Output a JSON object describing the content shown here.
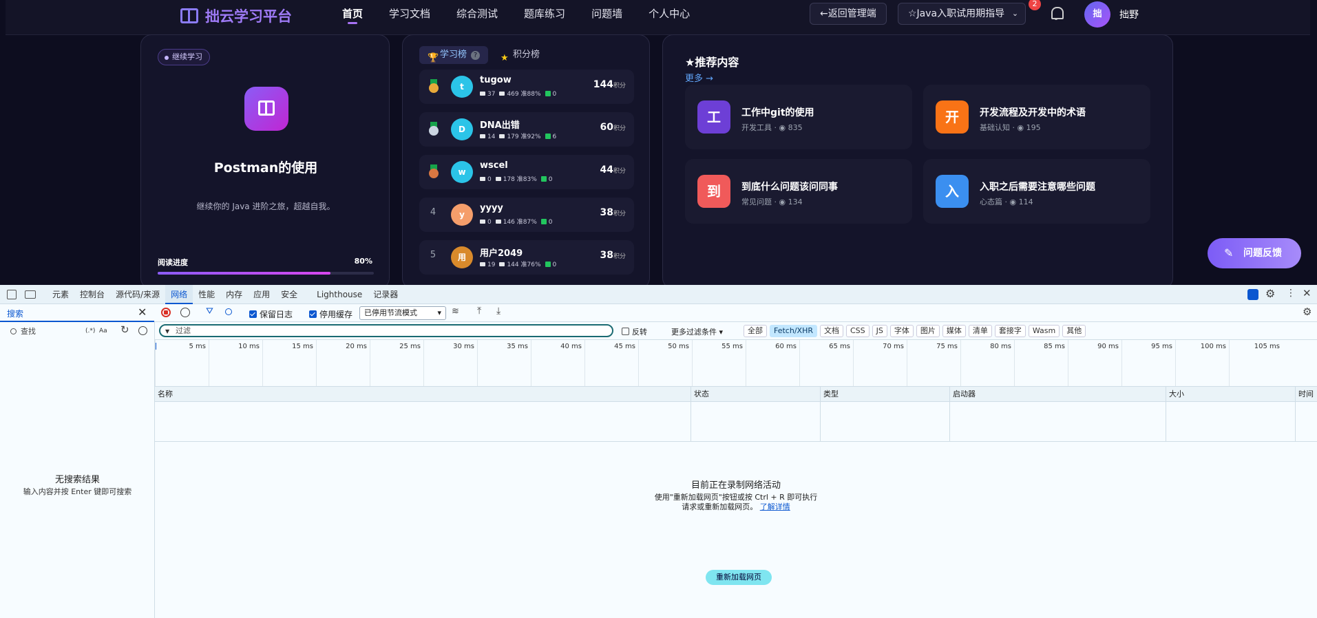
{
  "app": {
    "logo_text": "拙云学习平台",
    "nav": [
      "首页",
      "学习文档",
      "综合测试",
      "题库练习",
      "问题墙",
      "个人中心"
    ],
    "back_admin": "←返回管理端",
    "guide_select": "☆Java入职试用期指导",
    "notification_count": "2",
    "avatar_text": "拙",
    "username": "拙野"
  },
  "continue_card": {
    "chip": "继续学习",
    "title": "Postman的使用",
    "subtitle": "继续你的 Java 进阶之旅，超越自我。",
    "progress_label": "阅读进度",
    "progress_text": "80%",
    "progress_value": 0.8
  },
  "leaderboard": {
    "tab_study": "学习榜",
    "tab_points": "积分榜",
    "help": "?",
    "score_unit": "积分",
    "rows": [
      {
        "rank": "",
        "medal": "#e8a93a",
        "avatar": "t",
        "avatar_color": "#2bc4e8",
        "name": "tugow",
        "msgs": "37",
        "docs": "469 准88%",
        "done": "0",
        "score": "144"
      },
      {
        "rank": "",
        "medal": "#cbd5e1",
        "avatar": "D",
        "avatar_color": "#2bc4e8",
        "name": "DNA出错",
        "msgs": "14",
        "docs": "179 准92%",
        "done": "6",
        "score": "60"
      },
      {
        "rank": "",
        "medal": "#d97742",
        "avatar": "w",
        "avatar_color": "#2bc4e8",
        "name": "wscel",
        "msgs": "0",
        "docs": "178 准83%",
        "done": "0",
        "score": "44"
      },
      {
        "rank": "4",
        "medal": "",
        "avatar": "y",
        "avatar_color": "#f59e6b",
        "name": "yyyy",
        "msgs": "0",
        "docs": "146 准87%",
        "done": "0",
        "score": "38"
      },
      {
        "rank": "5",
        "medal": "",
        "avatar": "用",
        "avatar_color": "#d98a2b",
        "name": "用户2049",
        "msgs": "19",
        "docs": "144 准76%",
        "done": "0",
        "score": "38"
      }
    ]
  },
  "recommend": {
    "title": "★推荐内容",
    "more": "更多 →",
    "items": [
      {
        "icon": "工",
        "color": "#6d3fd6",
        "name": "工作中git的使用",
        "category": "开发工具",
        "views": "835"
      },
      {
        "icon": "开",
        "color": "#f97316",
        "name": "开发流程及开发中的术语",
        "category": "基础认知",
        "views": "195"
      },
      {
        "icon": "到",
        "color": "#f05a5a",
        "name": "到底什么问题该问同事",
        "category": "常见问题",
        "views": "134"
      },
      {
        "icon": "入",
        "color": "#3b8ff0",
        "name": "入职之后需要注意哪些问题",
        "category": "心态篇",
        "views": "114"
      }
    ]
  },
  "feedback": "问题反馈",
  "devtools": {
    "tabs": [
      "元素",
      "控制台",
      "源代码/来源",
      "网络",
      "性能",
      "内存",
      "应用",
      "安全",
      "Lighthouse",
      "记录器"
    ],
    "active_tab": "网络",
    "search_tab": "搜索",
    "search_placeholder": "查找",
    "regex": "(.*)",
    "case": "Aa",
    "preserve_log": "保留日志",
    "disable_cache": "停用缓存",
    "throttle": "已停用节流模式",
    "filter_placeholder": "过滤",
    "invert": "反转",
    "more_filters": "更多过滤条件 ▾",
    "types": [
      "全部",
      "Fetch/XHR",
      "文档",
      "CSS",
      "JS",
      "字体",
      "图片",
      "媒体",
      "清单",
      "套接字",
      "Wasm",
      "其他"
    ],
    "active_type": "Fetch/XHR",
    "ticks": [
      "5 ms",
      "10 ms",
      "15 ms",
      "20 ms",
      "25 ms",
      "30 ms",
      "35 ms",
      "40 ms",
      "45 ms",
      "50 ms",
      "55 ms",
      "60 ms",
      "65 ms",
      "70 ms",
      "75 ms",
      "80 ms",
      "85 ms",
      "90 ms",
      "95 ms",
      "100 ms",
      "105 ms"
    ],
    "columns": [
      "名称",
      "状态",
      "类型",
      "启动器",
      "大小",
      "时间"
    ],
    "no_results": "无搜索结果",
    "no_results_hint": "输入内容并按 Enter 键即可搜索",
    "recording_title": "目前正在录制网络活动",
    "recording_line1": "使用\"重新加载网页\"按钮或按 Ctrl + R 即可执行",
    "recording_line2": "请求或重新加载网页。",
    "learn_more": "了解详情",
    "reload_button": "重新加载网页"
  }
}
